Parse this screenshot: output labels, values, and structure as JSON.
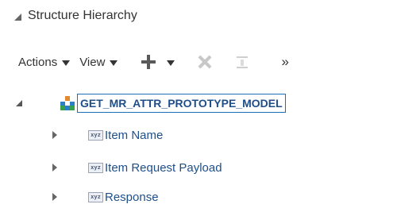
{
  "panel": {
    "title": "Structure Hierarchy"
  },
  "toolbar": {
    "actions_label": "Actions",
    "view_label": "View",
    "more_label": "»",
    "icons": [
      "add-icon",
      "chevron-down-icon",
      "delete-icon",
      "align-icon",
      "overflow-icon"
    ]
  },
  "tree": {
    "root": {
      "label": "GET_MR_ATTR_PROTOTYPE_MODEL",
      "icon": "model-icon",
      "expanded": true,
      "selected": true
    },
    "children": [
      {
        "label": "Item Name",
        "icon_text": "xyz",
        "expanded": false
      },
      {
        "label": "Item Request Payload",
        "icon_text": "xyz",
        "expanded": false
      },
      {
        "label": "Response",
        "icon_text": "xyz",
        "expanded": false
      }
    ]
  },
  "colors": {
    "link_blue": "#1f4f8a",
    "selection_border": "#1a6fb8",
    "disabled_gray": "#c8c8c8",
    "text": "#333333"
  }
}
